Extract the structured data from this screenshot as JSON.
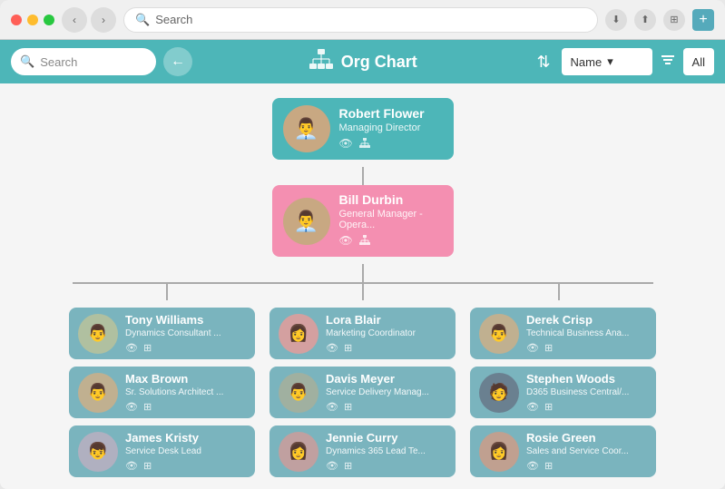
{
  "browser": {
    "search_placeholder": "Search",
    "new_tab_label": "+"
  },
  "topbar": {
    "search_placeholder": "Search",
    "back_icon": "←",
    "title": "Org Chart",
    "sort_icon": "⇅",
    "dropdown_label": "Name",
    "dropdown_icon": "▾",
    "filter_icon": "⊞",
    "all_label": "All"
  },
  "nodes": {
    "robert": {
      "name": "Robert Flower",
      "title": "Managing Director"
    },
    "bill": {
      "name": "Bill Durbin",
      "title": "General Manager - Opera..."
    },
    "tony": {
      "name": "Tony Williams",
      "title": "Dynamics Consultant ..."
    },
    "lora": {
      "name": "Lora Blair",
      "title": "Marketing Coordinator"
    },
    "derek": {
      "name": "Derek Crisp",
      "title": "Technical Business Ana..."
    },
    "max": {
      "name": "Max Brown",
      "title": "Sr. Solutions Architect ..."
    },
    "davis": {
      "name": "Davis Meyer",
      "title": "Service Delivery Manag..."
    },
    "stephen": {
      "name": "Stephen Woods",
      "title": "D365 Business Central/..."
    },
    "james": {
      "name": "James Kristy",
      "title": "Service Desk Lead"
    },
    "jennie": {
      "name": "Jennie Curry",
      "title": "Dynamics 365 Lead Te..."
    },
    "rosie": {
      "name": "Rosie Green",
      "title": "Sales and Service Coor..."
    }
  },
  "icons": {
    "eye": "👁",
    "org": "⊞",
    "search": "🔍"
  }
}
